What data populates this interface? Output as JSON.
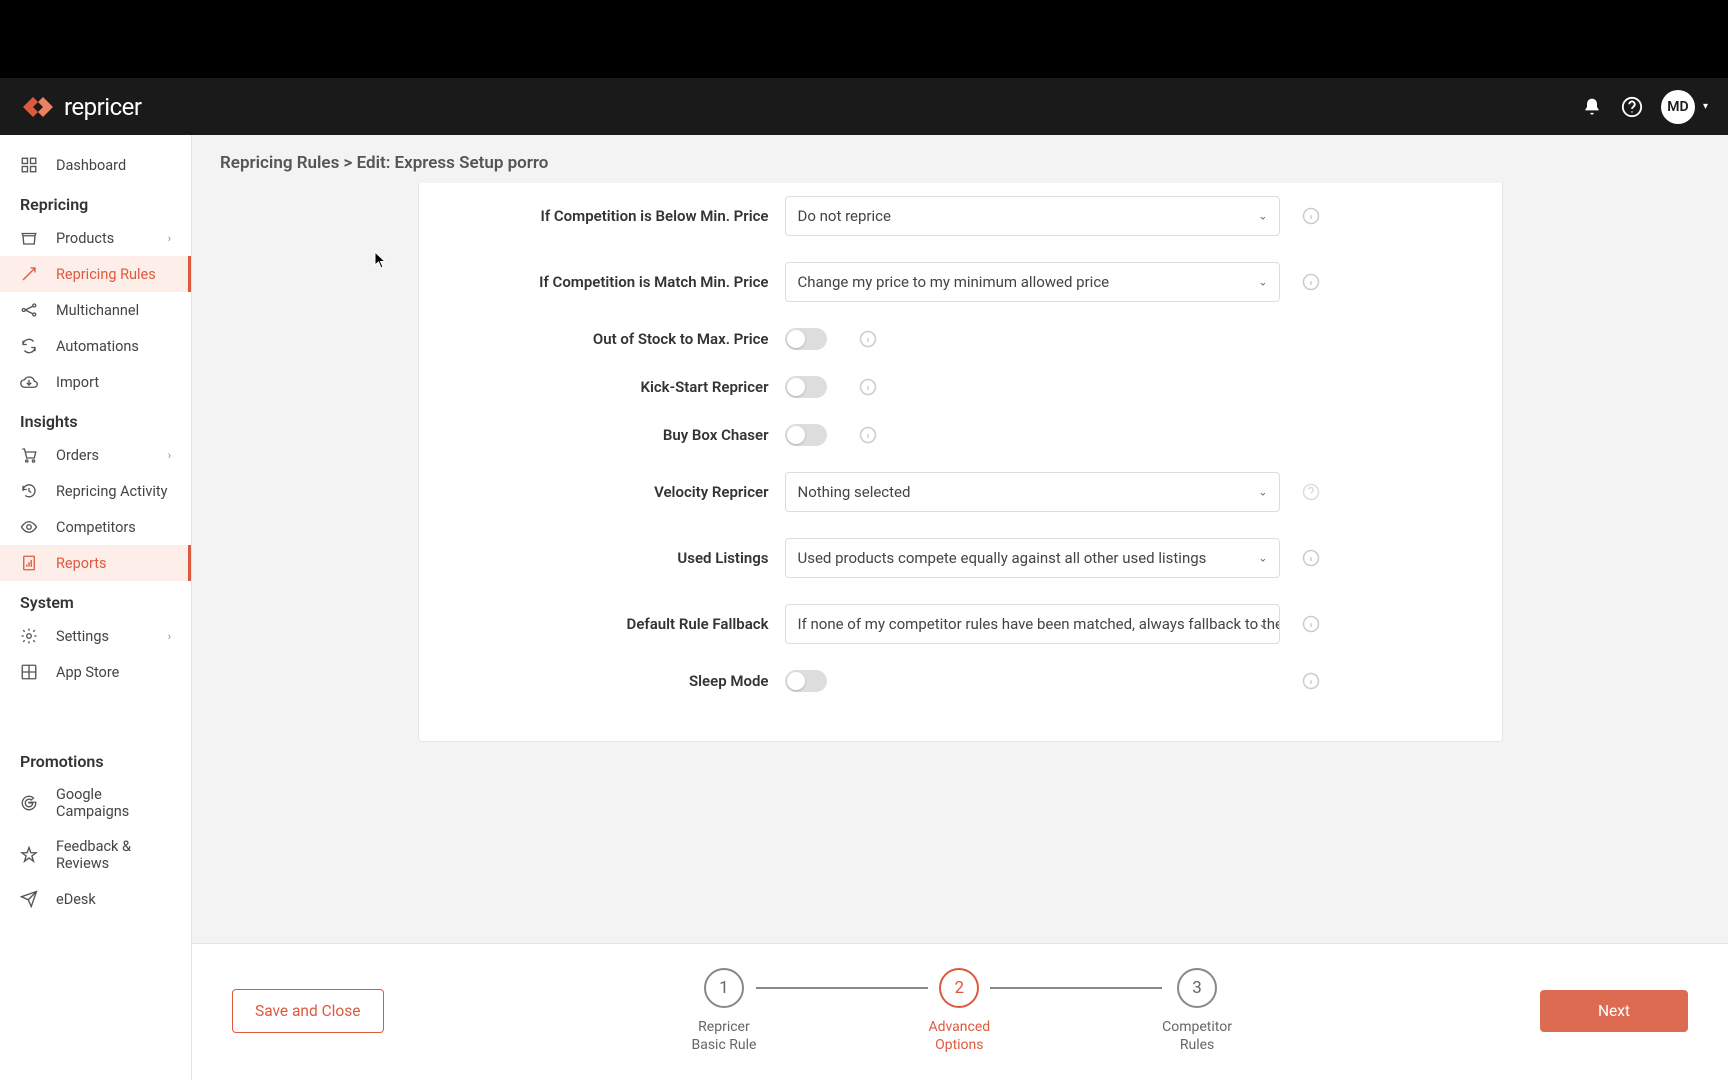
{
  "header": {
    "logo_text": "repricer",
    "avatar": "MD"
  },
  "sidebar": {
    "dashboard": "Dashboard",
    "sections": {
      "repricing": "Repricing",
      "insights": "Insights",
      "system": "System",
      "promotions": "Promotions"
    },
    "items": {
      "products": "Products",
      "repricing_rules": "Repricing Rules",
      "multichannel": "Multichannel",
      "automations": "Automations",
      "import": "Import",
      "orders": "Orders",
      "repricing_activity": "Repricing Activity",
      "competitors": "Competitors",
      "reports": "Reports",
      "settings": "Settings",
      "app_store": "App Store",
      "google_campaigns": "Google Campaigns",
      "feedback_reviews": "Feedback & Reviews",
      "edesk": "eDesk"
    }
  },
  "breadcrumb": "Repricing Rules > Edit: Express Setup porro",
  "form": {
    "below_min": {
      "label": "If Competition is Below Min. Price",
      "value": "Do not reprice"
    },
    "match_min": {
      "label": "If Competition is Match Min. Price",
      "value": "Change my price to my minimum allowed price"
    },
    "out_of_stock": {
      "label": "Out of Stock to Max. Price"
    },
    "kick_start": {
      "label": "Kick-Start Repricer"
    },
    "buy_box": {
      "label": "Buy Box Chaser"
    },
    "velocity": {
      "label": "Velocity Repricer",
      "value": "Nothing selected"
    },
    "used_listings": {
      "label": "Used Listings",
      "value": "Used products compete equally against all other used listings"
    },
    "fallback": {
      "label": "Default Rule Fallback",
      "value": "If none of my competitor rules have been matched, always fallback to the default re"
    },
    "sleep_mode": {
      "label": "Sleep Mode"
    }
  },
  "footer": {
    "save_close": "Save and Close",
    "next": "Next",
    "steps": {
      "s1": {
        "num": "1",
        "label": "Repricer\nBasic Rule"
      },
      "s2": {
        "num": "2",
        "label": "Advanced\nOptions"
      },
      "s3": {
        "num": "3",
        "label": "Competitor\nRules"
      }
    }
  }
}
